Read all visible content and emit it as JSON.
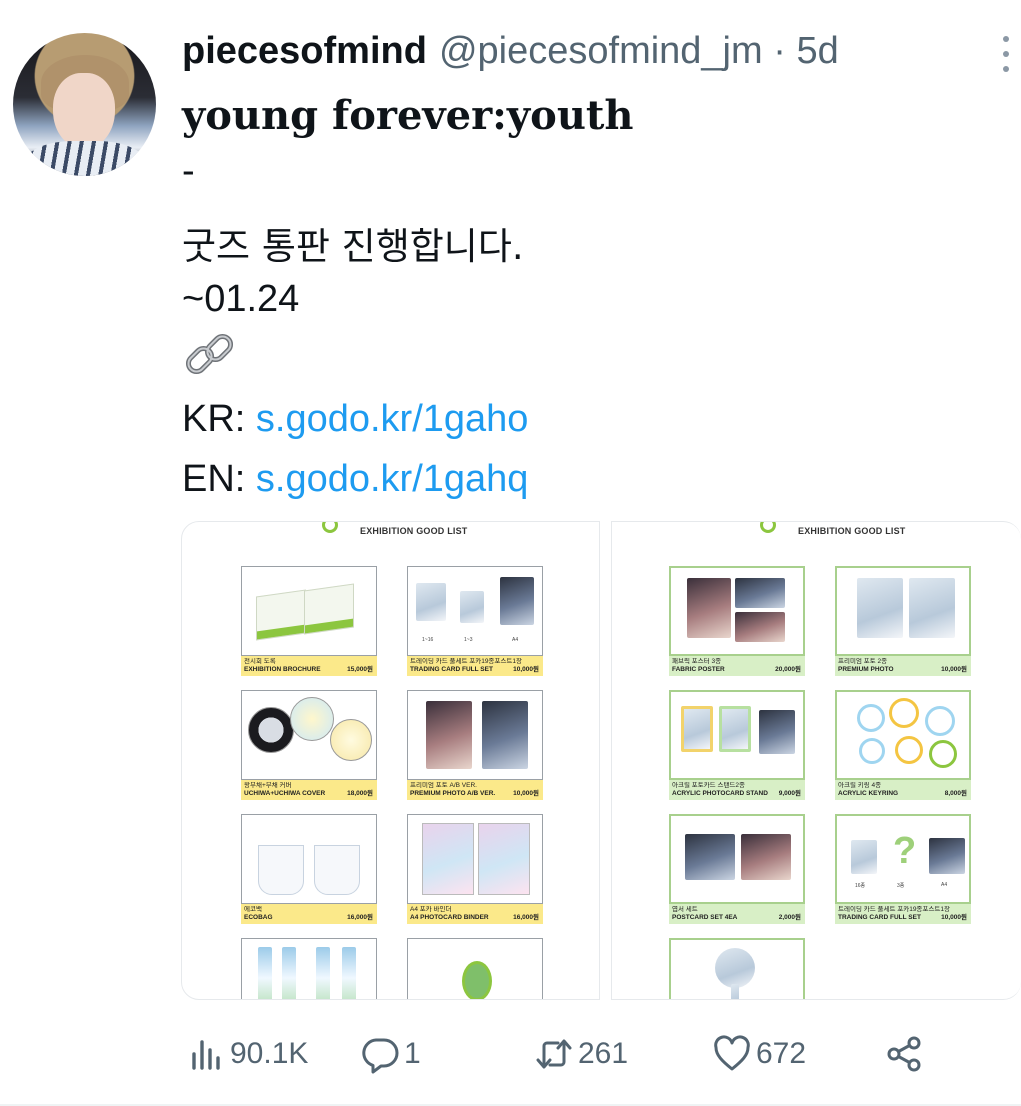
{
  "tweet": {
    "display_name": "piecesofmind",
    "handle": "@piecesofmind_jm",
    "separator": "·",
    "time": "5d",
    "lines": {
      "title": "young forever:youth",
      "dash": "-",
      "korean": "굿즈 통판 진행합니다.",
      "date": "~01.24",
      "link_emoji": "link-emoji"
    },
    "links": [
      {
        "label": "KR: ",
        "url": "s.godo.kr/1gaho"
      },
      {
        "label": "EN: ",
        "url": "s.godo.kr/1gahq"
      }
    ]
  },
  "media": {
    "panels": [
      {
        "header": "EXHIBITION GOOD LIST",
        "items": [
          {
            "ko": "전시회 도록",
            "en": "EXHIBITION BROCHURE",
            "price": "15,000원",
            "tags": []
          },
          {
            "ko": "트레이딩 카드 풀세트 포카19종포스트1장",
            "en": "TRADING CARD FULL SET",
            "price": "10,000원",
            "tags": [
              "1~16",
              "1~3",
              "A4"
            ]
          },
          {
            "ko": "왕부채+부채 커버",
            "en": "UCHIWA+UCHIWA COVER",
            "price": "18,000원",
            "tags": []
          },
          {
            "ko": "프리미엄 포토 A/B VER.",
            "en": "PREMIUM PHOTO A/B VER.",
            "price": "10,000원",
            "tags": []
          },
          {
            "ko": "에코백",
            "en": "ECOBAG",
            "price": "16,000원",
            "tags": []
          },
          {
            "ko": "A4 포카 바인더",
            "en": "A4 PHOTOCARD BINDER",
            "price": "16,000원",
            "tags": []
          }
        ]
      },
      {
        "header": "EXHIBITION GOOD LIST",
        "items": [
          {
            "ko": "패브릭 포스터 3종",
            "en": "FABRIC POSTER",
            "price": "20,000원",
            "tags": []
          },
          {
            "ko": "프리미엄 포토 2종",
            "en": "PREMIUM PHOTO",
            "price": "10,000원",
            "tags": []
          },
          {
            "ko": "아크릴 포토카드 스탠드2종",
            "en": "ACRYLIC PHOTOCARD STAND",
            "price": "9,000원",
            "tags": []
          },
          {
            "ko": "아크릴 키링 4종",
            "en": "ACRYLIC KEYRING",
            "price": "8,000원",
            "tags": []
          },
          {
            "ko": "엽서 세트",
            "en": "POSTCARD SET 4EA",
            "price": "2,000원",
            "tags": []
          },
          {
            "ko": "트레이딩 카드 풀세트 포카19종포스트1장",
            "en": "TRADING CARD FULL SET",
            "price": "10,000원",
            "tags": [
              "16종",
              "3종",
              "A4"
            ]
          }
        ]
      }
    ]
  },
  "actions": {
    "views": "90.1K",
    "replies": "1",
    "retweets": "261",
    "likes": "672"
  },
  "colors": {
    "link": "#1d9bf0",
    "muted": "#536471",
    "caption_yellow": "#fbe98a",
    "caption_green": "#d8efc6"
  }
}
